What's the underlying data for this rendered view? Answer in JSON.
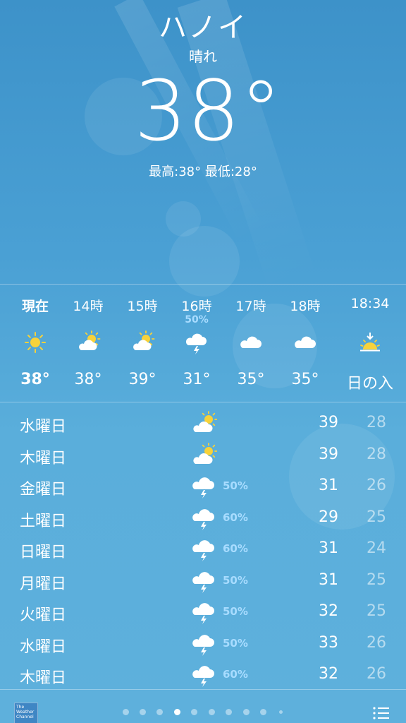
{
  "header": {
    "city": "ハノイ",
    "condition": "晴れ",
    "temperature": "38°",
    "hilo": "最高:38° 最低:28°"
  },
  "hourly": [
    {
      "time": "現在",
      "pct": "",
      "icon": "sun-icon",
      "temp": "38°",
      "now": true
    },
    {
      "time": "14時",
      "pct": "",
      "icon": "partly-cloudy-icon",
      "temp": "38°"
    },
    {
      "time": "15時",
      "pct": "",
      "icon": "partly-cloudy-icon",
      "temp": "39°"
    },
    {
      "time": "16時",
      "pct": "50%",
      "icon": "thunderstorm-icon",
      "temp": "31°"
    },
    {
      "time": "17時",
      "pct": "",
      "icon": "cloud-icon",
      "temp": "35°"
    },
    {
      "time": "18時",
      "pct": "",
      "icon": "cloud-icon",
      "temp": "35°"
    },
    {
      "time": "18:34",
      "pct": "",
      "icon": "sunset-icon",
      "temp": "日の入"
    }
  ],
  "daily": [
    {
      "day": "水曜日",
      "icon": "partly-cloudy-icon",
      "pct": "",
      "hi": "39",
      "lo": "28"
    },
    {
      "day": "木曜日",
      "icon": "partly-cloudy-icon",
      "pct": "",
      "hi": "39",
      "lo": "28"
    },
    {
      "day": "金曜日",
      "icon": "thunderstorm-icon",
      "pct": "50%",
      "hi": "31",
      "lo": "26"
    },
    {
      "day": "土曜日",
      "icon": "thunderstorm-icon",
      "pct": "60%",
      "hi": "29",
      "lo": "25"
    },
    {
      "day": "日曜日",
      "icon": "thunderstorm-icon",
      "pct": "60%",
      "hi": "31",
      "lo": "24"
    },
    {
      "day": "月曜日",
      "icon": "thunderstorm-icon",
      "pct": "50%",
      "hi": "31",
      "lo": "25"
    },
    {
      "day": "火曜日",
      "icon": "thunderstorm-icon",
      "pct": "50%",
      "hi": "32",
      "lo": "25"
    },
    {
      "day": "水曜日",
      "icon": "thunderstorm-icon",
      "pct": "50%",
      "hi": "33",
      "lo": "26"
    },
    {
      "day": "木曜日",
      "icon": "thunderstorm-icon",
      "pct": "60%",
      "hi": "32",
      "lo": "26"
    }
  ],
  "footer": {
    "logo_text": "The Weather Channel",
    "page_count": 10,
    "active_page": 3
  },
  "colors": {
    "sun": "#f7d23a",
    "precip": "#a8dcff"
  }
}
